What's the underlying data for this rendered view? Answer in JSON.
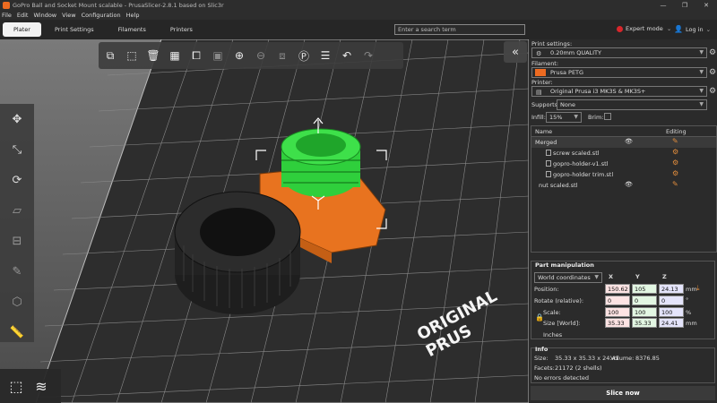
{
  "window": {
    "title": "GoPro Ball and Socket Mount scalable - PrusaSlicer-2.8.1 based on Slic3r",
    "controls": [
      "—",
      "❐",
      "✕"
    ]
  },
  "menu": [
    "File",
    "Edit",
    "Window",
    "View",
    "Configuration",
    "Help"
  ],
  "tabs": [
    "Plater",
    "Print Settings",
    "Filaments",
    "Printers"
  ],
  "search": {
    "placeholder": "Enter a search term"
  },
  "mode": {
    "label": "Expert mode"
  },
  "account": {
    "label": "Log in"
  },
  "sidebar": {
    "print_settings_label": "Print settings:",
    "print_profile": "0.20mm QUALITY",
    "filament_label": "Filament:",
    "filament_profile": "Prusa PETG",
    "filament_color": "#ed6b21",
    "printer_label": "Printer:",
    "printer_profile": "Original Prusa i3 MK3S & MK3S+",
    "supports_label": "Supports:",
    "supports_value": "None",
    "infill_label": "Infill:",
    "infill_value": "15%",
    "brim_label": "Brim:"
  },
  "object_list": {
    "col_name": "Name",
    "col_editing": "Editing",
    "rows": [
      {
        "name": "Merged",
        "indent": 0
      },
      {
        "name": "screw scaled.stl",
        "indent": 1
      },
      {
        "name": "gopro-holder-v1.stl",
        "indent": 1
      },
      {
        "name": "gopro-holder trim.stl",
        "indent": 1
      },
      {
        "name": "nut scaled.stl",
        "indent": 0
      }
    ]
  },
  "part_manipulation": {
    "title": "Part manipulation",
    "coords": "World coordinates",
    "axes": [
      "X",
      "Y",
      "Z"
    ],
    "position_label": "Position:",
    "position": [
      "150.62",
      "105",
      "24.13"
    ],
    "position_unit": "mm",
    "rotate_label": "Rotate (relative):",
    "rotate": [
      "0",
      "0",
      "0"
    ],
    "rotate_unit": "°",
    "scale_label": "Scale:",
    "scale": [
      "100",
      "100",
      "100"
    ],
    "scale_unit": "%",
    "size_label": "Size [World]:",
    "size": [
      "35.33",
      "35.33",
      "24.41"
    ],
    "size_unit": "mm",
    "inches_label": "Inches"
  },
  "info": {
    "title": "Info",
    "size_label": "Size:",
    "size_value": "35.33 x 35.33 x 24.41",
    "volume_label": "Volume:",
    "volume_value": "8376.85",
    "facets_label": "Facets:",
    "facets_value": "21172 (2 shells)",
    "errors": "No errors detected"
  },
  "slice_button": "Slice now",
  "bed_label": "ORIGINAL PRUS"
}
